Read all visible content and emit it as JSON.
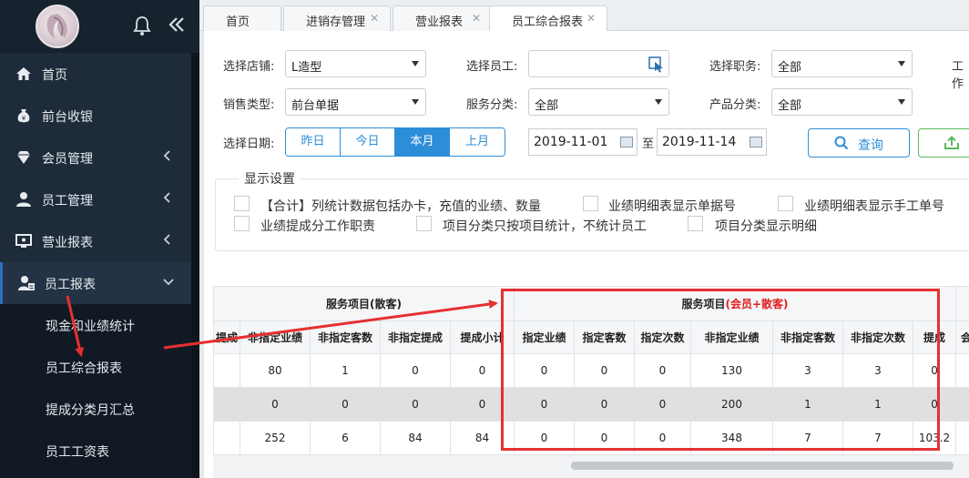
{
  "sidebar": {
    "menu": [
      {
        "label": "首页",
        "icon": "home-icon"
      },
      {
        "label": "前台收银",
        "icon": "money-bag-icon"
      },
      {
        "label": "会员管理",
        "icon": "diamond-icon"
      },
      {
        "label": "员工管理",
        "icon": "user-icon"
      },
      {
        "label": "营业报表",
        "icon": "monitor-icon"
      },
      {
        "label": "员工报表",
        "icon": "user-report-icon"
      }
    ],
    "submenu": [
      "现金和业绩统计",
      "员工综合报表",
      "提成分类月汇总",
      "员工工资表"
    ]
  },
  "tabs": [
    "首页",
    "进销存管理",
    "营业报表",
    "员工综合报表"
  ],
  "filters": {
    "store_label": "选择店铺:",
    "store_value": "L造型",
    "employee_label": "选择员工:",
    "position_label": "选择职务:",
    "position_value": "全部",
    "work_label": "工作",
    "sales_type_label": "销售类型:",
    "sales_type_value": "前台单据",
    "service_cat_label": "服务分类:",
    "service_cat_value": "全部",
    "product_cat_label": "产品分类:",
    "product_cat_value": "全部",
    "date_label": "选择日期:",
    "date_buttons": [
      "昨日",
      "今日",
      "本月",
      "上月"
    ],
    "date_active": "本月",
    "date_from": "2019-11-01",
    "date_sep": "至",
    "date_to": "2019-11-14",
    "query_label": "查询"
  },
  "display_settings": {
    "title": "显示设置",
    "options": [
      "【合计】列统计数据包括办卡，充值的业绩、数量",
      "业绩明细表显示单据号",
      "业绩明细表显示手工单号",
      "业绩提成分工作职责",
      "项目分类只按项目统计，不统计员工",
      "项目分类显示明细"
    ]
  },
  "table": {
    "group_left": "服务项目(散客)",
    "group_mid_prefix": "服务项目",
    "group_mid_suffix": "(会员+散客)",
    "headers": [
      "提成",
      "非指定业绩",
      "非指定客数",
      "非指定提成",
      "提成小计",
      "指定业绩",
      "指定客数",
      "指定次数",
      "非指定业绩",
      "非指定客数",
      "非指定次数",
      "提成",
      "会员"
    ],
    "rows": [
      [
        "",
        "80",
        "1",
        "0",
        "0",
        "0",
        "0",
        "0",
        "130",
        "3",
        "3",
        "0",
        ""
      ],
      [
        "",
        "0",
        "0",
        "0",
        "0",
        "0",
        "0",
        "0",
        "200",
        "1",
        "1",
        "0",
        ""
      ],
      [
        "",
        "252",
        "6",
        "84",
        "84",
        "0",
        "0",
        "0",
        "348",
        "7",
        "7",
        "103.2",
        ""
      ]
    ]
  },
  "colors": {
    "accent": "#2d8ed8",
    "highlight": "#e63030",
    "sidebar": "#1e2b3a"
  }
}
